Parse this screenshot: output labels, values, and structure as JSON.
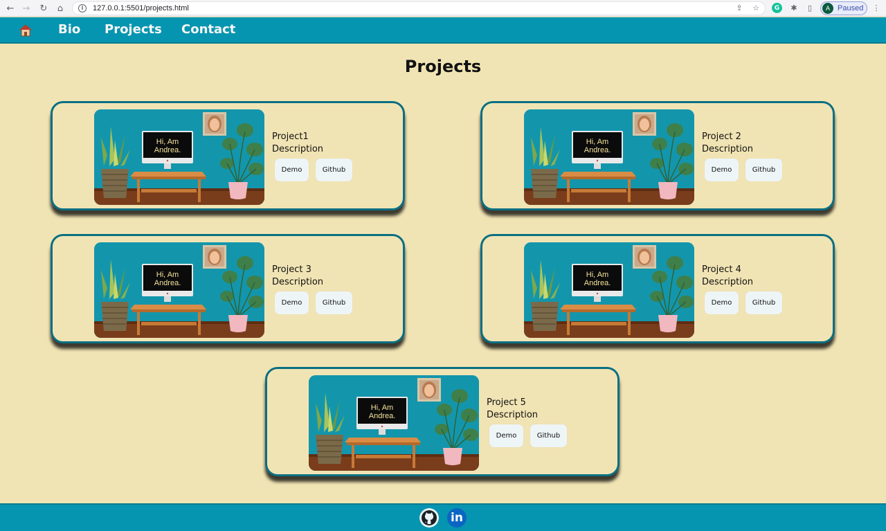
{
  "browser": {
    "url": "127.0.0.1:5501/projects.html",
    "profile_initial": "A",
    "profile_status": "Paused"
  },
  "nav": {
    "links": [
      "Bio",
      "Projects",
      "Contact"
    ]
  },
  "page": {
    "title": "Projects"
  },
  "projects": [
    {
      "name": "Project1",
      "description": "Description",
      "demo_label": "Demo",
      "github_label": "Github"
    },
    {
      "name": "Project 2",
      "description": "Description",
      "demo_label": "Demo",
      "github_label": "Github"
    },
    {
      "name": "Project 3",
      "description": "Description",
      "demo_label": "Demo",
      "github_label": "Github"
    },
    {
      "name": "Project 4",
      "description": "Description",
      "demo_label": "Demo",
      "github_label": "Github"
    },
    {
      "name": "Project 5",
      "description": "Description",
      "demo_label": "Demo",
      "github_label": "Github"
    }
  ],
  "thumbnail": {
    "screen_text": [
      "Hi, Am",
      "Andrea."
    ]
  },
  "footer": {
    "icons": [
      "github-icon",
      "linkedin-icon"
    ],
    "linkedin_text": "in"
  },
  "colors": {
    "nav_bg": "#0695b0",
    "page_bg": "#f1e4b4",
    "card_border": "#0a6f82"
  }
}
